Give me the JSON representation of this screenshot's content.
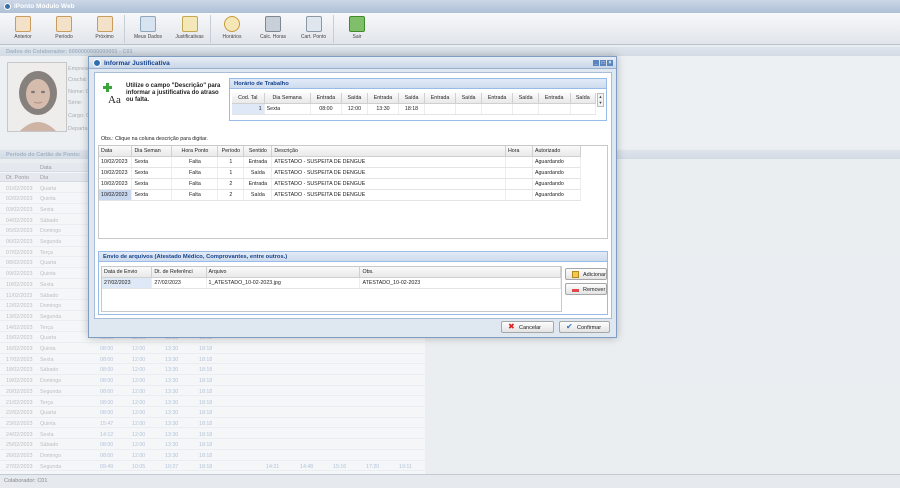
{
  "app": {
    "title": "iPonto Módulo Web"
  },
  "toolbar": {
    "items": [
      {
        "label": "Anterior"
      },
      {
        "label": "Período"
      },
      {
        "label": "Próximo"
      },
      {
        "label": "Meus Dados"
      },
      {
        "label": "Justificativas"
      },
      {
        "label": "Horários"
      },
      {
        "label": "Calc. Horas"
      },
      {
        "label": "Cart. Ponto"
      },
      {
        "label": "Sair"
      }
    ]
  },
  "collaborator": {
    "section_title": "Dados do Colaborador: 0000000000000001 - C01",
    "fields": [
      "Empresa",
      "Crachá:",
      "Nome: C",
      "Série:",
      "Cargo: C",
      "Departa"
    ]
  },
  "period": {
    "section_title": "Período do Cartão de Ponto:",
    "headers": [
      "Data",
      "Dia"
    ],
    "subheaders": [
      "Dt. Ponto",
      "Dia"
    ],
    "rows": [
      {
        "d": "01/02/2023",
        "w": "Quarta",
        "t": []
      },
      {
        "d": "02/02/2023",
        "w": "Quinta",
        "t": []
      },
      {
        "d": "03/02/2023",
        "w": "Sexta",
        "t": []
      },
      {
        "d": "04/02/2023",
        "w": "Sábado",
        "t": []
      },
      {
        "d": "05/02/2023",
        "w": "Domingo",
        "t": []
      },
      {
        "d": "06/02/2023",
        "w": "Segunda",
        "t": []
      },
      {
        "d": "07/02/2023",
        "w": "Terça",
        "t": []
      },
      {
        "d": "08/02/2023",
        "w": "Quarta",
        "t": []
      },
      {
        "d": "09/02/2023",
        "w": "Quinta",
        "t": []
      },
      {
        "d": "10/02/2023",
        "w": "Sexta",
        "t": []
      },
      {
        "d": "11/02/2023",
        "w": "Sábado",
        "t": []
      },
      {
        "d": "12/02/2023",
        "w": "Domingo",
        "t": []
      },
      {
        "d": "13/02/2023",
        "w": "Segunda",
        "t": []
      },
      {
        "d": "14/02/2023",
        "w": "Terça",
        "t": []
      },
      {
        "d": "15/02/2023",
        "w": "Quarta",
        "t": [
          "08:00",
          "12:00",
          "13:30",
          "18:18"
        ]
      },
      {
        "d": "16/02/2023",
        "w": "Quinta",
        "t": [
          "08:00",
          "12:00",
          "13:30",
          "18:18"
        ]
      },
      {
        "d": "17/02/2023",
        "w": "Sexta",
        "t": [
          "08:00",
          "12:00",
          "13:30",
          "18:18"
        ]
      },
      {
        "d": "18/02/2023",
        "w": "Sábado",
        "t": [
          "08:00",
          "12:00",
          "13:30",
          "18:18"
        ]
      },
      {
        "d": "19/02/2023",
        "w": "Domingo",
        "t": [
          "08:00",
          "12:00",
          "13:30",
          "18:18"
        ]
      },
      {
        "d": "20/02/2023",
        "w": "Segunda",
        "t": [
          "08:00",
          "12:00",
          "13:30",
          "18:18"
        ]
      },
      {
        "d": "21/02/2023",
        "w": "Terça",
        "t": [
          "08:00",
          "12:00",
          "13:30",
          "18:18"
        ]
      },
      {
        "d": "22/02/2023",
        "w": "Quarta",
        "t": [
          "08:00",
          "12:00",
          "13:30",
          "18:18"
        ]
      },
      {
        "d": "23/02/2023",
        "w": "Quinta",
        "t": [
          "15:47",
          "12:00",
          "13:30",
          "18:18"
        ]
      },
      {
        "d": "24/02/2023",
        "w": "Sexta",
        "t": [
          "14:12",
          "12:00",
          "13:30",
          "18:18"
        ]
      },
      {
        "d": "25/02/2023",
        "w": "Sábado",
        "t": [
          "08:00",
          "12:00",
          "13:30",
          "18:18"
        ]
      },
      {
        "d": "26/02/2023",
        "w": "Domingo",
        "t": [
          "08:00",
          "12:00",
          "13:30",
          "18:18"
        ]
      },
      {
        "d": "27/02/2023",
        "w": "Segunda",
        "t": [
          "09:49",
          "10:05",
          "10:27",
          "18:18",
          "14:21",
          "14:48",
          "15:16",
          "17:20",
          "19:11"
        ]
      }
    ]
  },
  "statusbar": {
    "text": "Colaborador: C01"
  },
  "dialog": {
    "title": "Informar Justificativa",
    "info": "Utilize o campo \"Descrição\" para informar a justificativa do atraso ou falta.",
    "schedule": {
      "title": "Horário de Trabalho",
      "headers": [
        "Cod. Tal",
        "Dia Semana",
        "Entrada",
        "Saída",
        "Entrada",
        "Saída",
        "Entrada",
        "Saída",
        "Entrada",
        "Saída",
        "Entrada",
        "Saída"
      ],
      "row": [
        "1",
        "Sexta",
        "08:00",
        "12:00",
        "13:30",
        "18:18",
        "",
        "",
        "",
        "",
        "",
        ""
      ]
    },
    "obs": "Obs.: Clique na coluna descrição para digitar.",
    "justifications": {
      "headers": [
        "Data",
        "Dia Seman",
        "Hora Ponto",
        "Período",
        "Sentido",
        "Descrição",
        "Hora",
        "Autorizado"
      ],
      "rows": [
        [
          "10/02/2023",
          "Sexta",
          "Falta",
          "1",
          "Entrada",
          "ATESTADO - SUSPEITA DE DENGUE",
          "",
          "Aguardando"
        ],
        [
          "10/02/2023",
          "Sexta",
          "Falta",
          "1",
          "Saída",
          "ATESTADO - SUSPEITA DE DENGUE",
          "",
          "Aguardando"
        ],
        [
          "10/02/2023",
          "Sexta",
          "Falta",
          "2",
          "Entrada",
          "ATESTADO - SUSPEITA DE DENGUE",
          "",
          "Aguardando"
        ],
        [
          "10/02/2023",
          "Sexta",
          "Falta",
          "2",
          "Saída",
          "ATESTADO - SUSPEITA DE DENGUE",
          "",
          "Aguardando"
        ]
      ]
    },
    "files": {
      "title": "Envio de arquivos (Atestado Médico, Comprovantes, entre outros.)",
      "headers": [
        "Data de Envio",
        "Dt. de Referênci",
        "Arquivo",
        "Obs."
      ],
      "rows": [
        [
          "27/02/2023",
          "27/02/2023",
          "1_ATESTADO_10-02-2023.jpg",
          "ATESTADO_10-02-2023"
        ]
      ],
      "add_label": "Adicionar",
      "remove_label": "Remover"
    },
    "cancel_label": "Cancelar",
    "confirm_label": "Confirmar"
  }
}
